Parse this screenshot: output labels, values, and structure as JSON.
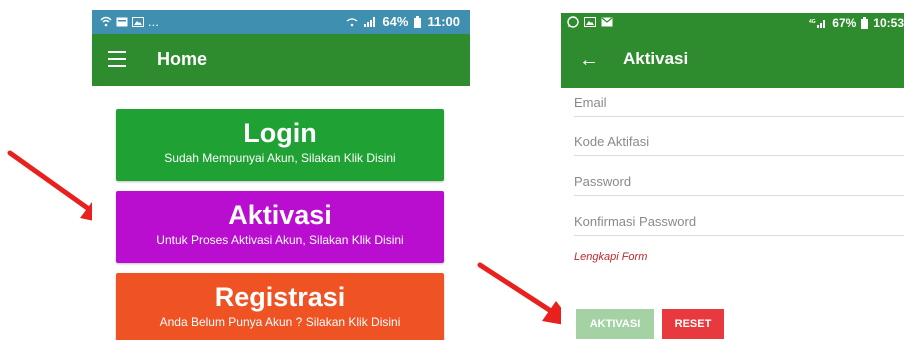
{
  "left_screen": {
    "status_bar": {
      "dots": "...",
      "battery": "64%",
      "time": "11:00"
    },
    "app_bar": {
      "title": "Home",
      "menu_icon": "hamburger-icon"
    },
    "buttons": [
      {
        "title": "Login",
        "subtitle": "Sudah Mempunyai Akun, Silakan Klik Disini",
        "color": "#1fa233"
      },
      {
        "title": "Aktivasi",
        "subtitle": "Untuk Proses Aktivasi Akun, Silakan Klik Disini",
        "color": "#b90ed0"
      },
      {
        "title": "Registrasi",
        "subtitle": "Anda Belum Punya Akun ? Silakan Klik Disini",
        "color": "#ef5223"
      }
    ]
  },
  "right_screen": {
    "status_bar": {
      "battery": "67%",
      "time": "10:53"
    },
    "app_bar": {
      "title": "Aktivasi",
      "back_icon": "back-arrow-icon"
    },
    "fields": [
      {
        "placeholder": "Email",
        "value": ""
      },
      {
        "placeholder": "Kode Aktifasi",
        "value": ""
      },
      {
        "placeholder": "Password",
        "value": ""
      },
      {
        "placeholder": "Konfirmasi Password",
        "value": ""
      }
    ],
    "hint": "Lengkapi Form",
    "buttons": {
      "activate": "AKTIVASI",
      "reset": "RESET"
    }
  },
  "colors": {
    "app_bar": "#2e8b2e",
    "status_bar_left": "#3f8fb0",
    "arrow": "#e8211f",
    "hint": "#c0272d"
  },
  "annotations": [
    "red-arrow-to-aktivasi-button",
    "red-arrow-to-aktivasi-submit"
  ]
}
